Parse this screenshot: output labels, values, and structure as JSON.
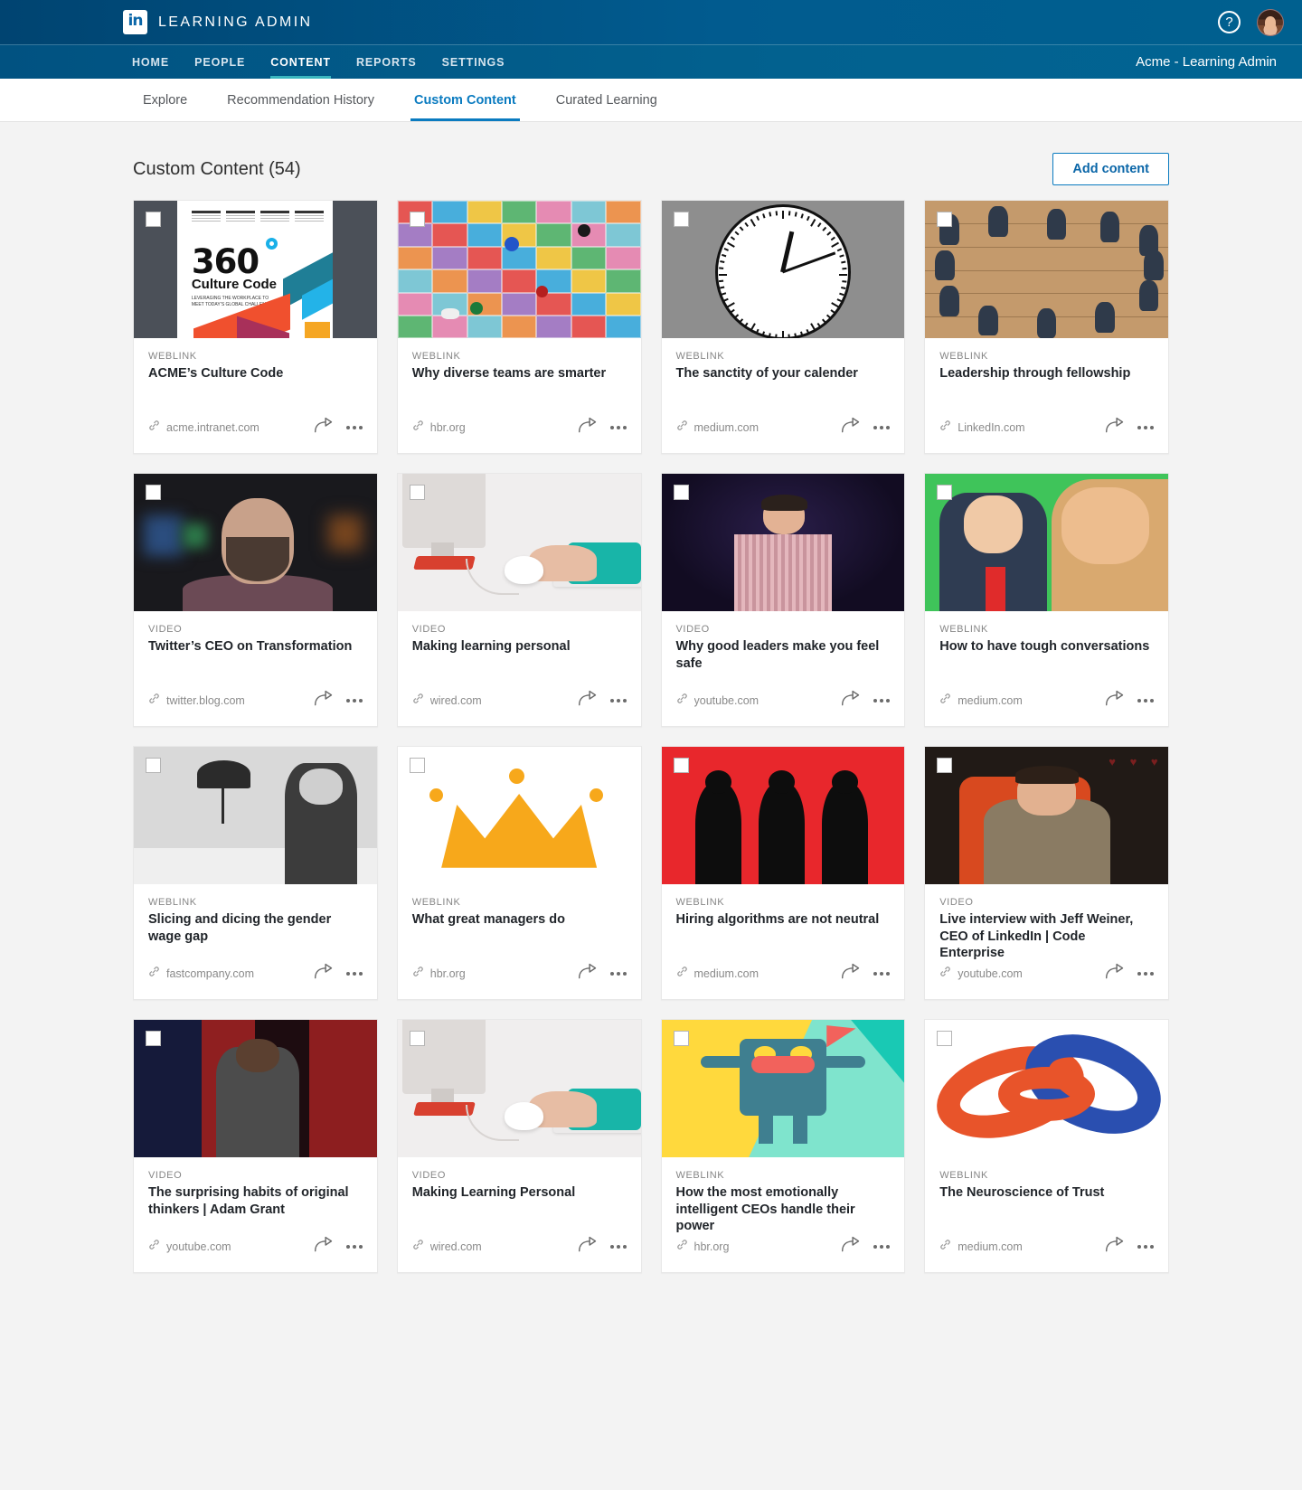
{
  "topbar": {
    "logo_text": "in",
    "brand_title": "LEARNING ADMIN",
    "help_icon": "help-circle-icon",
    "avatar": "user-avatar"
  },
  "nav": {
    "items": [
      {
        "label": "HOME",
        "active": false
      },
      {
        "label": "PEOPLE",
        "active": false
      },
      {
        "label": "CONTENT",
        "active": true
      },
      {
        "label": "REPORTS",
        "active": false
      },
      {
        "label": "SETTINGS",
        "active": false
      }
    ],
    "org_label": "Acme - Learning Admin"
  },
  "subnav": {
    "items": [
      {
        "label": "Explore",
        "active": false
      },
      {
        "label": "Recommendation History",
        "active": false
      },
      {
        "label": "Custom Content",
        "active": true
      },
      {
        "label": "Curated Learning",
        "active": false
      }
    ]
  },
  "page": {
    "title": "Custom Content (54)",
    "add_button": "Add content"
  },
  "cards": [
    {
      "kicker": "WEBLINK",
      "title": "ACME’s Culture Code",
      "url": "acme.intranet.com",
      "art": "art-culture"
    },
    {
      "kicker": "WEBLINK",
      "title": "Why diverse teams are smarter",
      "url": "hbr.org",
      "art": "art-board"
    },
    {
      "kicker": "WEBLINK",
      "title": "The sanctity of your calender",
      "url": "medium.com",
      "art": "art-clock"
    },
    {
      "kicker": "WEBLINK",
      "title": "Leadership through fellowship",
      "url": "LinkedIn.com",
      "art": "art-wood"
    },
    {
      "kicker": "VIDEO",
      "title": "Twitter’s CEO on Transformation",
      "url": "twitter.blog.com",
      "art": "art-twitter"
    },
    {
      "kicker": "VIDEO",
      "title": "Making learning personal",
      "url": "wired.com",
      "art": "art-desk"
    },
    {
      "kicker": "VIDEO",
      "title": "Why good leaders make you feel safe",
      "url": "youtube.com",
      "art": "art-stage"
    },
    {
      "kicker": "WEBLINK",
      "title": "How to have tough conversations",
      "url": "medium.com",
      "art": "art-comic"
    },
    {
      "kicker": "WEBLINK",
      "title": "Slicing and dicing the gender wage gap",
      "url": "fastcompany.com",
      "art": "art-office"
    },
    {
      "kicker": "WEBLINK",
      "title": "What great managers do",
      "url": "hbr.org",
      "art": "art-crown"
    },
    {
      "kicker": "WEBLINK",
      "title": "Hiring algorithms are not neutral",
      "url": "medium.com",
      "art": "art-red"
    },
    {
      "kicker": "VIDEO",
      "title": "Live interview with Jeff Weiner, CEO of LinkedIn | Code Enterprise",
      "url": "youtube.com",
      "art": "art-jeff"
    },
    {
      "kicker": "VIDEO",
      "title": "The surprising habits of original thinkers | Adam Grant",
      "url": "youtube.com",
      "art": "art-adam"
    },
    {
      "kicker": "VIDEO",
      "title": "Making Learning Personal",
      "url": "wired.com",
      "art": "art-desk"
    },
    {
      "kicker": "WEBLINK",
      "title": "How the most emotionally intelligent CEOs handle their power",
      "url": "hbr.org",
      "art": "art-monster"
    },
    {
      "kicker": "WEBLINK",
      "title": "The Neuroscience of Trust",
      "url": "medium.com",
      "art": "art-knot"
    }
  ],
  "card_icons": {
    "link": "link-icon",
    "share": "share-icon",
    "more": "more-options-icon",
    "checkbox": "select-checkbox"
  },
  "colors": {
    "brand_blue": "#0a7bc0",
    "header_blue": "#015281",
    "accent_teal": "#3ab6bf",
    "page_bg": "#f3f3f3"
  }
}
